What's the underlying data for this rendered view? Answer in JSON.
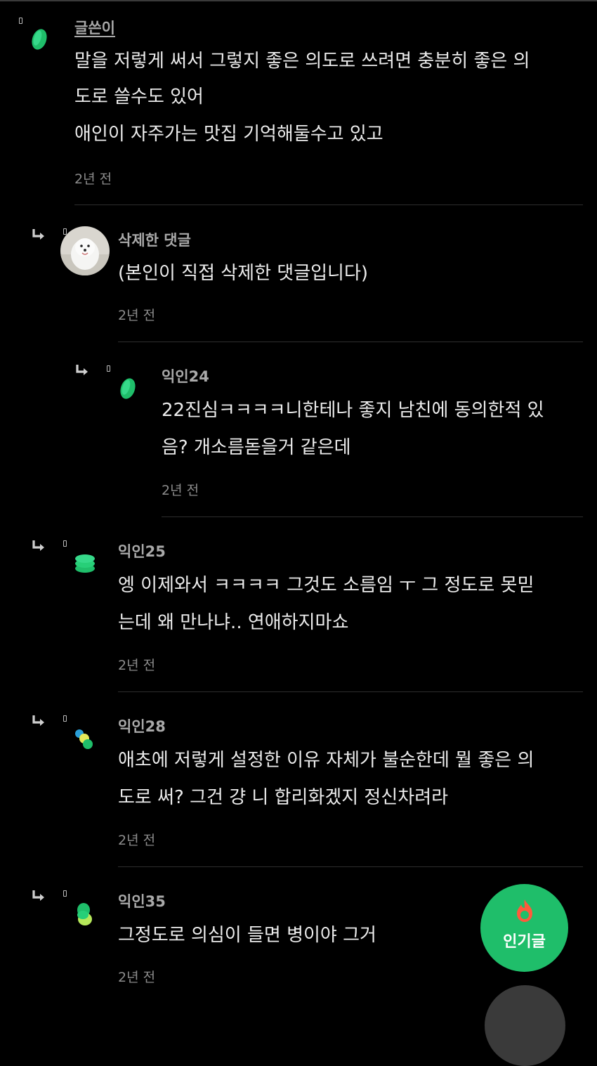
{
  "comments": [
    {
      "name": "글쓴이",
      "lines": [
        "말을 저렇게 써서 그렇지 좋은 의도로 쓰려면 충분히 좋은 의",
        "도로 쓸수도 있어",
        "애인이 자주가는 맛집 기억해둘수고 있고"
      ],
      "time": "2년 전"
    },
    {
      "name": "삭제한 댓글",
      "lines": [
        "(본인이 직접 삭제한 댓글입니다)"
      ],
      "time": "2년 전"
    },
    {
      "name": "익인24",
      "lines": [
        "22진심ㅋㅋㅋㅋ니한테나 좋지 남친에 동의한적 있",
        "음? 개소름돋을거 같은데"
      ],
      "time": "2년 전"
    },
    {
      "name": "익인25",
      "lines": [
        "엥 이제와서 ㅋㅋㅋㅋ 그것도 소름임 ㅜ 그 정도로 못믿",
        "는데 왜 만나냐.. 연애하지마쇼"
      ],
      "time": "2년 전"
    },
    {
      "name": "익인28",
      "lines": [
        "애초에 저렇게 설정한 이유 자체가 불순한데 뭘 좋은 의",
        "도로 써? 그건 걍 니 합리화겠지 정신차려라"
      ],
      "time": "2년 전"
    },
    {
      "name": "익인35",
      "lines": [
        "그정도로 의심이 들면 병이야 그거"
      ],
      "time": "2년 전"
    }
  ],
  "fab": {
    "label": "인기글",
    "icon": "fire-icon"
  },
  "colors": {
    "accent": "#1fbe6a",
    "background": "#000000"
  }
}
